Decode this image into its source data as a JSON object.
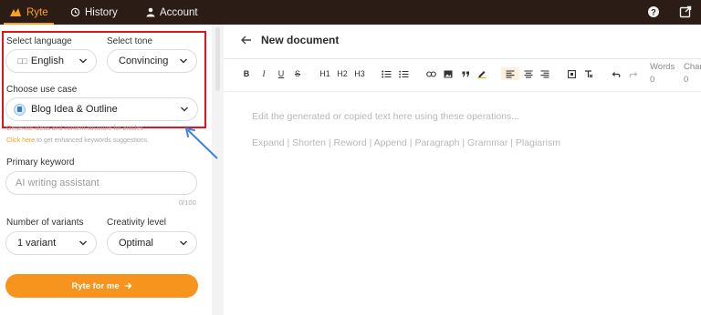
{
  "nav": {
    "brand": "Ryte",
    "history": "History",
    "account": "Account"
  },
  "language": {
    "label": "Select language",
    "value": "English",
    "flag": "□□"
  },
  "tone": {
    "label": "Select tone",
    "value": "Convincing"
  },
  "use_case": {
    "label": "Choose use case",
    "value": "Blog Idea & Outline",
    "description": "Generate ideas and content structure for articles",
    "link_text": "Click here",
    "link_suffix": " to get enhanced keywords suggestions."
  },
  "keyword": {
    "label": "Primary keyword",
    "placeholder": "AI writing assistant",
    "counter": "0/100"
  },
  "variants": {
    "label": "Number of variants",
    "value": "1 variant"
  },
  "creativity": {
    "label": "Creativity level",
    "value": "Optimal"
  },
  "cta": {
    "label": "Ryte for me"
  },
  "editor": {
    "title": "New document",
    "toolbar": {
      "bold": "B",
      "italic": "I",
      "underline": "U",
      "strike": "S",
      "h1": "H1",
      "h2": "H2",
      "h3": "H3"
    },
    "words_label": "Words",
    "words_value": "0",
    "chars_label": "Char",
    "chars_value": "0",
    "placeholder_line1": "Edit the generated or copied text here using these operations...",
    "placeholder_line2": "Expand | Shorten | Reword | Append | Paragraph | Grammar | Plagiarism"
  },
  "colors": {
    "topbar": "#2b1d16",
    "accent": "#f6a21d",
    "cta": "#f7941d",
    "highlight": "#e0141e",
    "annotation_arrow": "#3b82e6"
  }
}
